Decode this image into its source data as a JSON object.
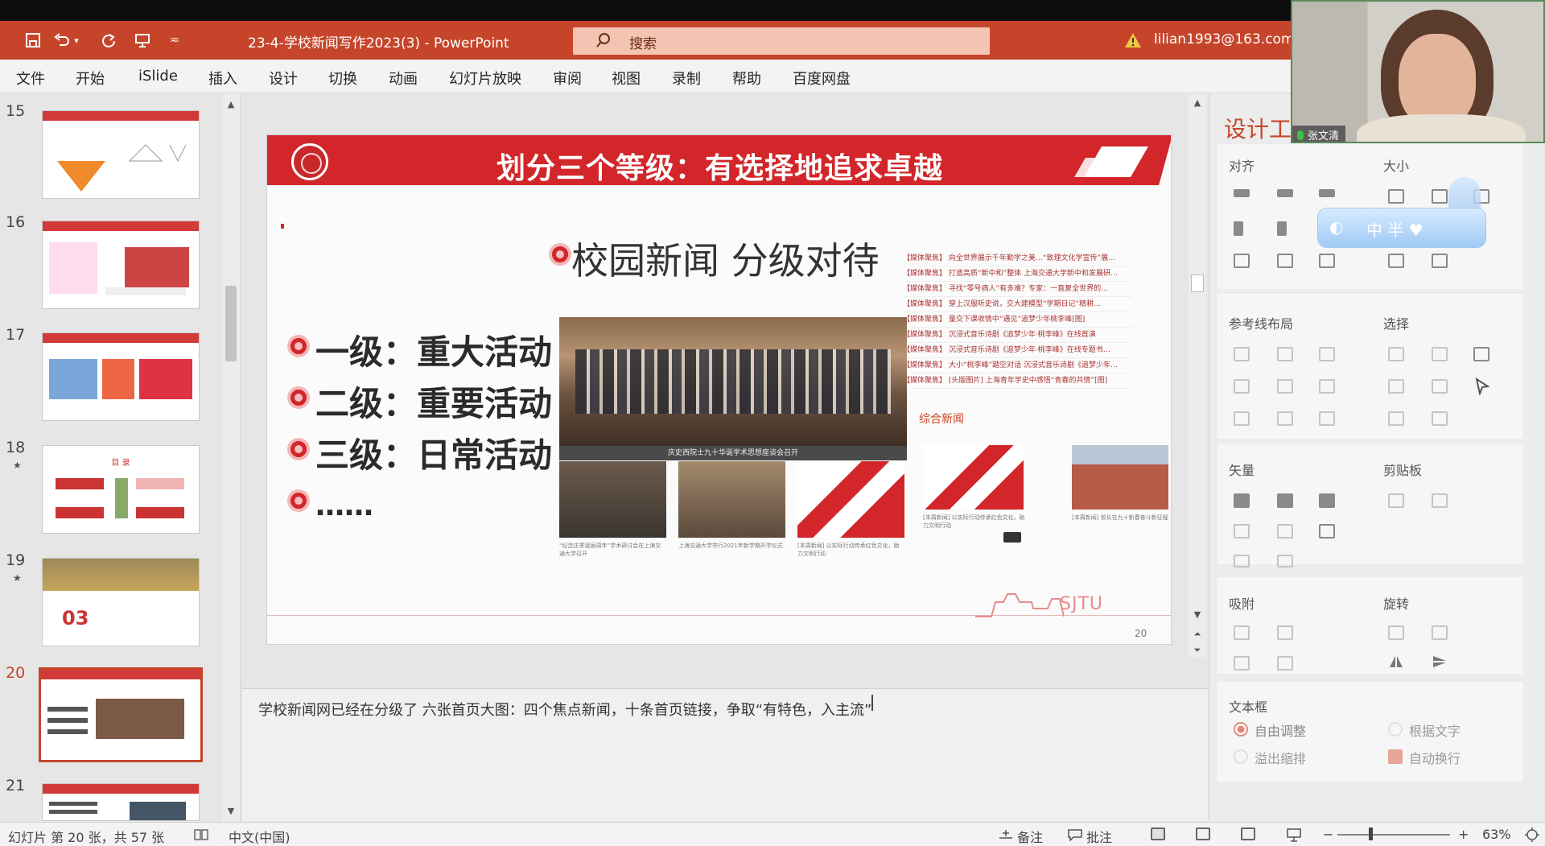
{
  "titlebar": {
    "doc_title": "23-4-学校新闻写作2023(3)  -  PowerPoint",
    "search_label": "搜索",
    "account": "lilian1993@163.com"
  },
  "ribbon": {
    "tabs": [
      "文件",
      "开始",
      "iSlide",
      "插入",
      "设计",
      "切换",
      "动画",
      "幻灯片放映",
      "审阅",
      "视图",
      "录制",
      "帮助",
      "百度网盘"
    ]
  },
  "thumbnails": [
    {
      "num": "15",
      "star": "",
      "caption": ""
    },
    {
      "num": "16",
      "star": "",
      "caption": ""
    },
    {
      "num": "17",
      "star": "",
      "caption": ""
    },
    {
      "num": "18",
      "star": "★",
      "caption": "目 录"
    },
    {
      "num": "19",
      "star": "★",
      "caption": "03"
    },
    {
      "num": "20",
      "star": "",
      "caption": ""
    },
    {
      "num": "21",
      "star": "",
      "caption": ""
    }
  ],
  "slide": {
    "title": "划分三个等级：有选择地追求卓越",
    "subtitle": "校园新闻 分级对待",
    "levels": [
      "一级：重大活动",
      "二级：重要活动",
      "三级：日常活动"
    ],
    "ellipsis": "……",
    "news_items": [
      "【媒体聚焦】 向全世界展示千年勤学之美…“致理文化学宣传”展…",
      "【媒体聚焦】 打造高质“新中和”整体 上海交通大学新中和发展研…",
      "【媒体聚焦】 寻找“零号病人”有多难？专家：一直复全世界的…",
      "【媒体聚焦】 穿上汉服听史说，交大建模型“学期日记”精耕…",
      "【媒体聚焦】 量交下课收情中“遇见”追梦少年桃李峰[图]",
      "【媒体聚焦】 沉浸式音乐诗剧《追梦少年·桃李峰》在线首演",
      "【媒体聚焦】 沉浸式音乐诗剧《追梦少年·桃李峰》在线专题书…",
      "【媒体聚焦】 大小“桃李峰”踏空对话 沉浸式音乐诗剧《追梦少年…",
      "【媒体聚焦】 [头版图片] 上海青年学史中感悟“青春的共情”[图]"
    ],
    "section_label": "综合新闻",
    "photo_caption": "庆史西院士九十华诞学术思想座谈会召开",
    "thumb_captions": [
      "“纪念庄季诞辰周年”学术研讨会在上海交通大学召开",
      "上海交通大学举行2021年新学期开学仪式",
      "[本周新闻] 以实际行动传承红色文化，助力文明行动",
      "[本周新闻] 以实际行动传承红色文化，助力文明行动",
      "[本周新闻] 校长在九十新春奋斗新征程"
    ],
    "logo_text": "SJTU",
    "page_number": "20"
  },
  "notes": {
    "text": "学校新闻网已经在分级了 六张首页大图：四个焦点新闻，十条首页链接，争取“有特色，入主流”"
  },
  "design_pane": {
    "title": "设计工",
    "sections": {
      "align": "对齐",
      "size": "大小",
      "guides": "参考线布局",
      "select": "选择",
      "vector": "矢量",
      "clipboard": "剪贴板",
      "snap": "吸附",
      "rotate": "旋转",
      "textbox": "文本框"
    },
    "textbox_options": {
      "auto_adjust": "自由调整",
      "fit_text": "根据文字",
      "overflow_shrink": "溢出缩排",
      "auto_wrap": "自动换行"
    }
  },
  "video": {
    "name": "张文清"
  },
  "ime": {
    "chars": "中 半 ♥"
  },
  "statusbar": {
    "slide_info": "幻灯片 第 20 张，共 57 张",
    "language": "中文(中国)",
    "notes_label": "备注",
    "comments_label": "批注",
    "zoom_minus": "−",
    "zoom_plus": "+",
    "zoom": "63%"
  },
  "colors": {
    "accent": "#c6452a",
    "slide_red": "#d2262a"
  }
}
